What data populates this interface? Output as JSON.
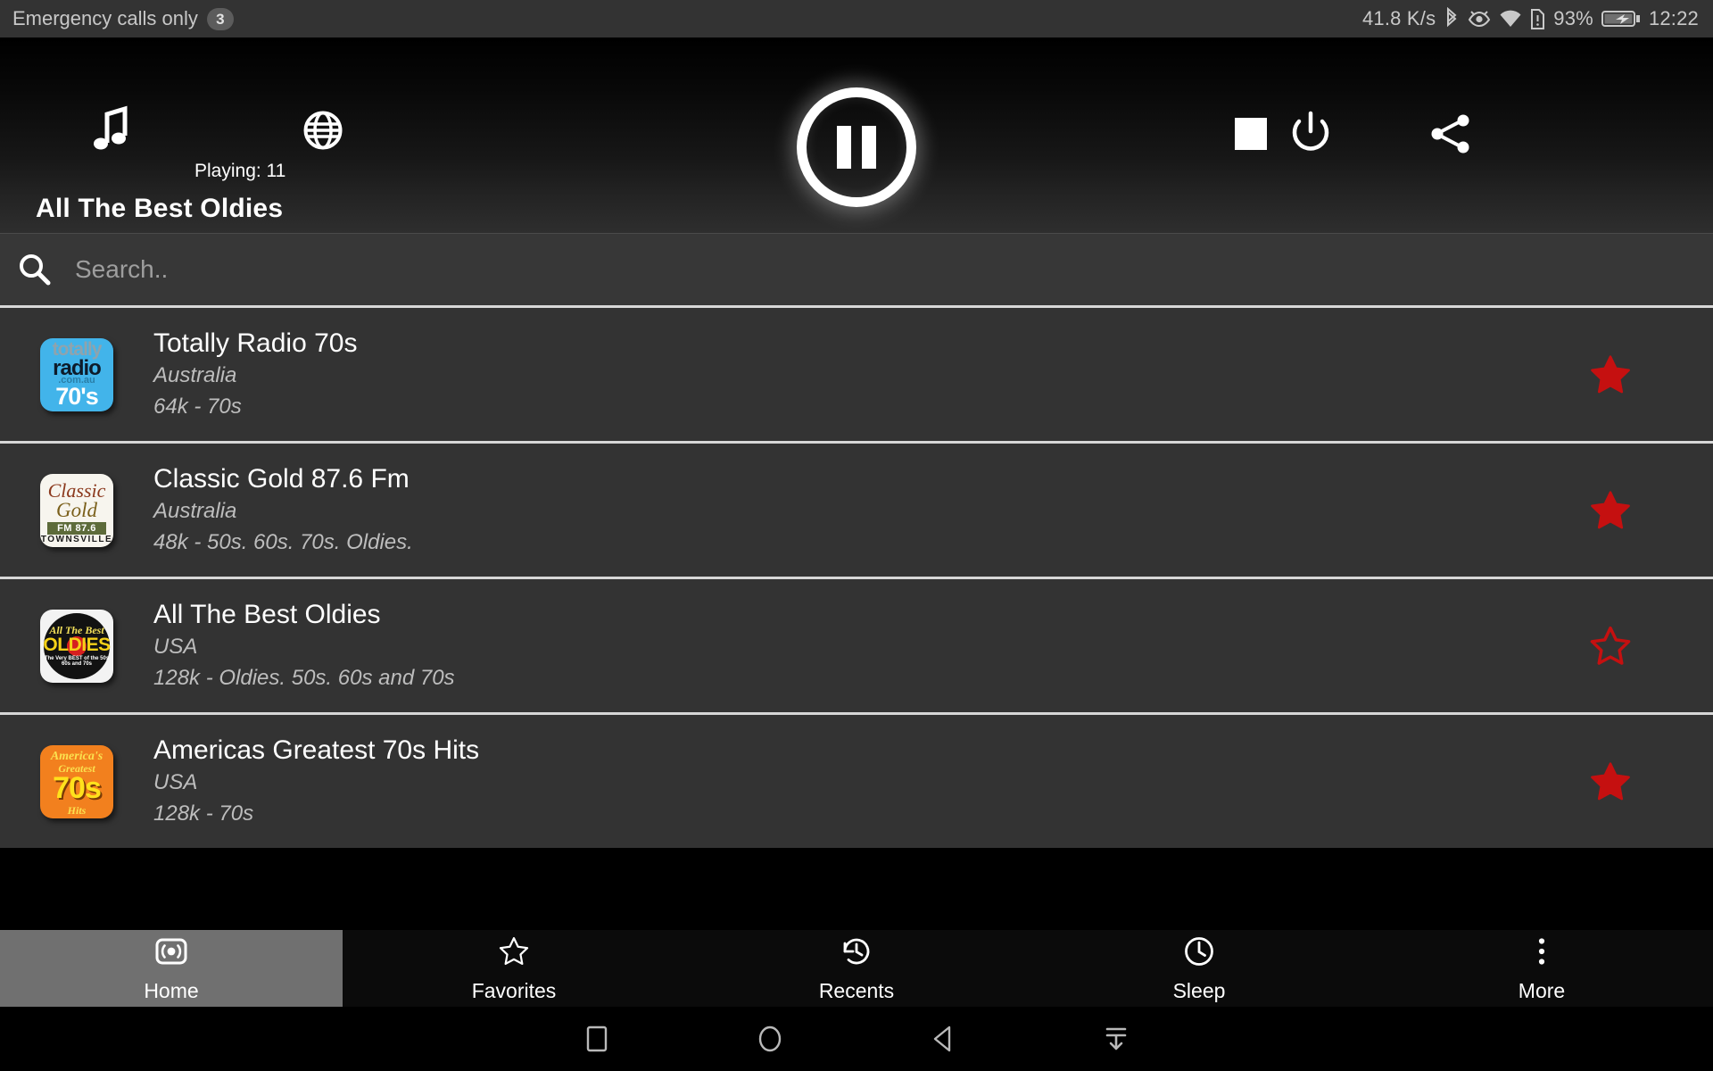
{
  "statusbar": {
    "carrier": "Emergency calls only",
    "notification_count": "3",
    "network_speed": "41.8 K/s",
    "battery_percent": "93%",
    "clock": "12:22",
    "icons": [
      "bluetooth-icon",
      "eye-icon",
      "wifi-icon",
      "sim-alert-icon",
      "battery-charging-icon"
    ]
  },
  "player": {
    "music_icon": "music-note-icon",
    "globe_icon": "globe-icon",
    "playing_label": "Playing: 11",
    "pause_icon": "pause-icon",
    "stop_icon": "stop-icon",
    "power_icon": "power-icon",
    "share_icon": "share-icon",
    "now_playing_title": "All The Best Oldies"
  },
  "search": {
    "icon": "search-icon",
    "value": "",
    "placeholder": "Search.."
  },
  "stations": [
    {
      "name": "Totally Radio 70s",
      "country": "Australia",
      "rate": "64k - 70s",
      "favorite": true,
      "logo": {
        "kind": "totally",
        "line1": "totally",
        "line2": "radio",
        "line3": ".com.au",
        "line4": "70's"
      }
    },
    {
      "name": "Classic Gold 87.6 Fm",
      "country": "Australia",
      "rate": "48k - 50s. 60s. 70s. Oldies.",
      "favorite": true,
      "logo": {
        "kind": "classic",
        "line1": "Classic",
        "line2": "Gold",
        "line3": "FM 87.6",
        "line4": "TOWNSVILLE"
      }
    },
    {
      "name": "All The Best Oldies",
      "country": "USA",
      "rate": "128k - Oldies. 50s. 60s and 70s",
      "favorite": false,
      "logo": {
        "kind": "oldies",
        "line1": "All The Best",
        "line2": "OLDIES",
        "line3": "The Very BEST of the 50s 60s and 70s"
      }
    },
    {
      "name": "Americas Greatest 70s Hits",
      "country": "USA",
      "rate": "128k - 70s",
      "favorite": true,
      "logo": {
        "kind": "greatest",
        "line1": "America's",
        "line2": "Greatest",
        "line3": "70s",
        "line4": "Hits"
      }
    }
  ],
  "tabs": [
    {
      "label": "Home",
      "icon": "radio-broadcast-icon",
      "active": true
    },
    {
      "label": "Favorites",
      "icon": "star-outline-icon",
      "active": false
    },
    {
      "label": "Recents",
      "icon": "history-icon",
      "active": false
    },
    {
      "label": "Sleep",
      "icon": "clock-icon",
      "active": false
    },
    {
      "label": "More",
      "icon": "overflow-dots-icon",
      "active": false
    }
  ],
  "navbar": {
    "recents_icon": "square-recents-icon",
    "home_icon": "circle-home-icon",
    "back_icon": "triangle-back-icon",
    "hide_icon": "hide-navbar-icon"
  },
  "colors": {
    "favorite_star": "#c51010",
    "list_bg": "#333333",
    "header_bg": "#2e2e2e",
    "tab_active_bg": "#707070"
  }
}
